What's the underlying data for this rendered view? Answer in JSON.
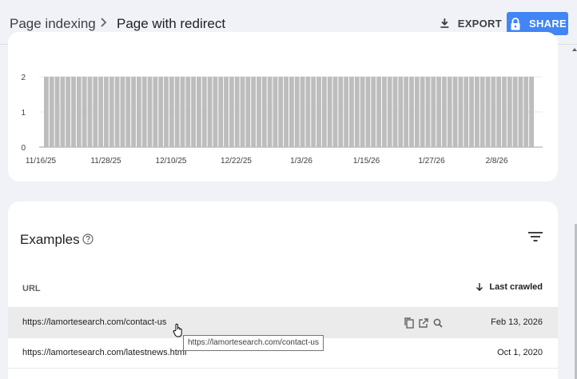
{
  "header": {
    "breadcrumb_parent": "Page indexing",
    "breadcrumb_current": "Page with redirect",
    "export_label": "EXPORT",
    "share_label": "SHARE"
  },
  "chart_data": {
    "type": "bar",
    "title": "",
    "xlabel": "",
    "ylabel": "",
    "ylim": [
      0,
      2
    ],
    "y_ticks": [
      "0",
      "1",
      "2"
    ],
    "x_tick_labels": [
      "11/16/25",
      "11/28/25",
      "12/10/25",
      "12/22/25",
      "1/3/26",
      "1/15/26",
      "1/27/26",
      "2/8/26"
    ],
    "bar_color": "#bdbdbd",
    "grid": true,
    "values": [
      2,
      2,
      2,
      2,
      2,
      2,
      2,
      2,
      2,
      2,
      2,
      2,
      2,
      2,
      2,
      2,
      2,
      2,
      2,
      2,
      2,
      2,
      2,
      2,
      2,
      2,
      2,
      2,
      2,
      2,
      2,
      2,
      2,
      2,
      2,
      2,
      2,
      2,
      2,
      2,
      2,
      2,
      2,
      2,
      2,
      2,
      2,
      2,
      2,
      2,
      2,
      2,
      2,
      2,
      2,
      2,
      2,
      2,
      2,
      2,
      2,
      2,
      2,
      2,
      2,
      2,
      2,
      2,
      2,
      2,
      2,
      2,
      2,
      2,
      2,
      2,
      2,
      2,
      2,
      2,
      2,
      2,
      2,
      2,
      2,
      2,
      2,
      2,
      2,
      2
    ]
  },
  "examples": {
    "title": "Examples",
    "col_url": "URL",
    "col_last_crawled": "Last crawled",
    "rows": [
      {
        "url": "https://lamortesearch.com/contact-us",
        "date": "Feb 13, 2026"
      },
      {
        "url": "https://lamortesearch.com/latestnews.html",
        "date": "Oct 1, 2020"
      }
    ],
    "tooltip": "https://lamortesearch.com/contact-us"
  },
  "colors": {
    "accent": "#4285f4",
    "background": "#f0f2f7",
    "bar": "#bdbdbd"
  }
}
